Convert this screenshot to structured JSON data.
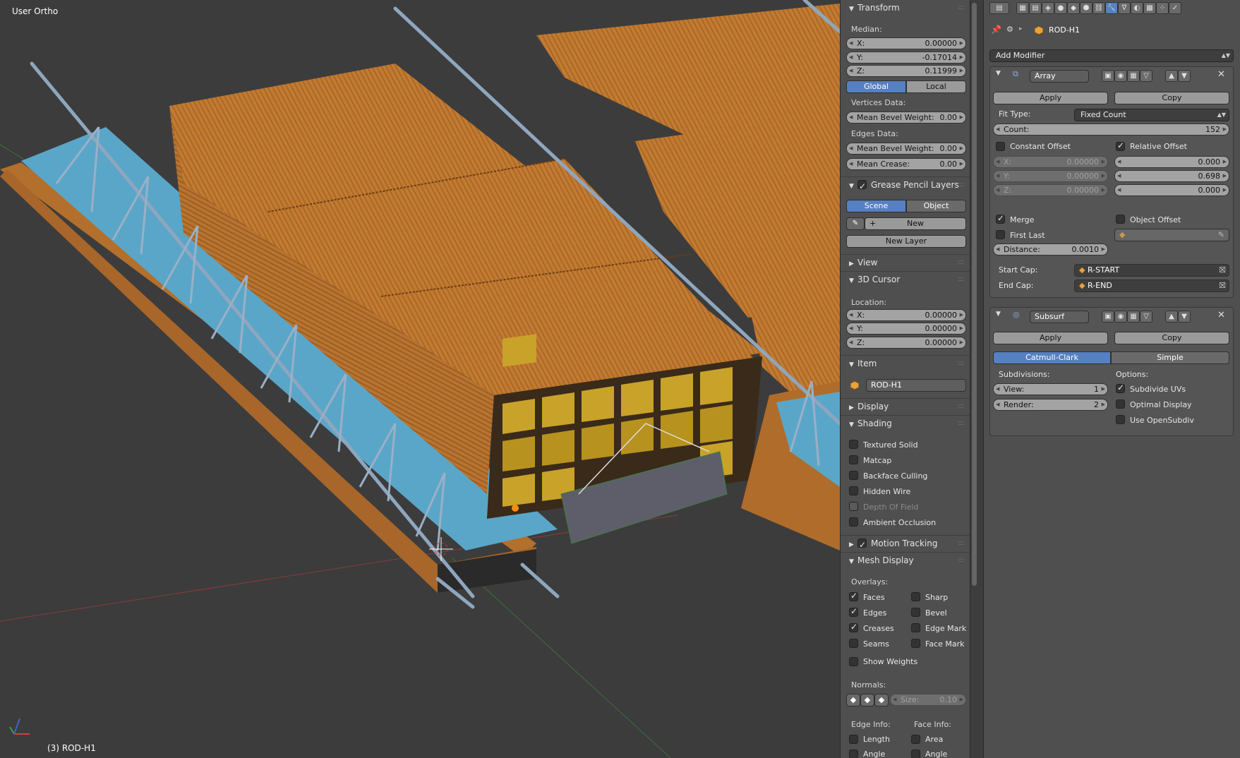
{
  "viewport": {
    "mode_label": "User Ortho",
    "object_label": "(3) ROD-H1"
  },
  "npanel": {
    "transform": {
      "title": "Transform",
      "median_label": "Median:",
      "x": {
        "label": "X:",
        "value": "0.00000"
      },
      "y": {
        "label": "Y:",
        "value": "-0.17014"
      },
      "z": {
        "label": "Z:",
        "value": "0.11999"
      },
      "global_label": "Global",
      "local_label": "Local",
      "vertices_data_label": "Vertices Data:",
      "vert_bevel": {
        "label": "Mean Bevel Weight:",
        "value": "0.00"
      },
      "edges_data_label": "Edges Data:",
      "edge_bevel": {
        "label": "Mean Bevel Weight:",
        "value": "0.00"
      },
      "crease": {
        "label": "Mean Crease:",
        "value": "0.00"
      }
    },
    "grease_pencil": {
      "title": "Grease Pencil Layers",
      "scene_label": "Scene",
      "object_label": "Object",
      "new_label": "New",
      "new_layer_label": "New Layer"
    },
    "view_title": "View",
    "cursor": {
      "title": "3D Cursor",
      "location_label": "Location:",
      "x": {
        "label": "X:",
        "value": "0.00000"
      },
      "y": {
        "label": "Y:",
        "value": "0.00000"
      },
      "z": {
        "label": "Z:",
        "value": "0.00000"
      }
    },
    "item": {
      "title": "Item",
      "name": "ROD-H1"
    },
    "display_title": "Display",
    "shading": {
      "title": "Shading",
      "options": [
        {
          "label": "Textured Solid",
          "checked": false,
          "dim": false
        },
        {
          "label": "Matcap",
          "checked": false,
          "dim": false
        },
        {
          "label": "Backface Culling",
          "checked": false,
          "dim": false
        },
        {
          "label": "Hidden Wire",
          "checked": false,
          "dim": false
        },
        {
          "label": "Depth Of Field",
          "checked": false,
          "dim": true
        },
        {
          "label": "Ambient Occlusion",
          "checked": false,
          "dim": false
        }
      ]
    },
    "motion_tracking_title": "Motion Tracking",
    "mesh_display": {
      "title": "Mesh Display",
      "overlays_label": "Overlays:",
      "left": [
        {
          "label": "Faces",
          "checked": true
        },
        {
          "label": "Edges",
          "checked": true
        },
        {
          "label": "Creases",
          "checked": true
        },
        {
          "label": "Seams",
          "checked": false
        }
      ],
      "right": [
        {
          "label": "Sharp",
          "checked": false
        },
        {
          "label": "Bevel",
          "checked": false
        },
        {
          "label": "Edge Mark",
          "checked": false
        },
        {
          "label": "Face Mark",
          "checked": false
        }
      ],
      "show_weights": "Show Weights",
      "normals_label": "Normals:",
      "size": {
        "label": "Size:",
        "value": "0.10"
      },
      "edge_info_label": "Edge Info:",
      "face_info_label": "Face Info:",
      "edge_info": [
        "Length",
        "Angle"
      ],
      "face_info": [
        "Area",
        "Angle"
      ]
    }
  },
  "props": {
    "object_name": "ROD-H1",
    "add_modifier": "Add Modifier",
    "array": {
      "name": "Array",
      "apply": "Apply",
      "copy": "Copy",
      "fit_type_label": "Fit Type:",
      "fit_type_value": "Fixed Count",
      "count": {
        "label": "Count:",
        "value": "152"
      },
      "constant_offset": "Constant Offset",
      "relative_offset": "Relative Offset",
      "const": {
        "x": {
          "label": "X:",
          "value": "0.00000"
        },
        "y": {
          "label": "Y:",
          "value": "0.00000"
        },
        "z": {
          "label": "Z:",
          "value": "0.00000"
        }
      },
      "rel": {
        "x": "0.000",
        "y": "0.698",
        "z": "0.000"
      },
      "merge": "Merge",
      "object_offset": "Object Offset",
      "first_last": "First Last",
      "distance": {
        "label": "Distance:",
        "value": "0.0010"
      },
      "start_cap_label": "Start Cap:",
      "start_cap_value": "R-START",
      "end_cap_label": "End Cap:",
      "end_cap_value": "R-END"
    },
    "subsurf": {
      "name": "Subsurf",
      "apply": "Apply",
      "copy": "Copy",
      "catmull": "Catmull-Clark",
      "simple": "Simple",
      "subdivisions_label": "Subdivisions:",
      "options_label": "Options:",
      "view": {
        "label": "View:",
        "value": "1"
      },
      "render": {
        "label": "Render:",
        "value": "2"
      },
      "subdivide_uvs": "Subdivide UVs",
      "optimal_display": "Optimal Display",
      "use_opensubdiv": "Use OpenSubdiv"
    }
  },
  "colors": {
    "accent": "#5680c2",
    "wood": "#c07a2e",
    "water": "#5aa6c8",
    "rod": "#8fa6be"
  }
}
